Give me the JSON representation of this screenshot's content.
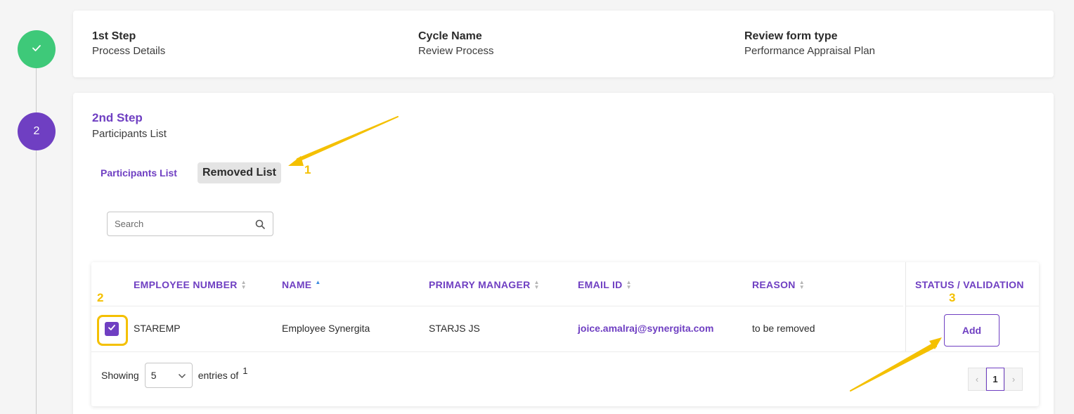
{
  "step1": {
    "items": [
      {
        "title": "1st Step",
        "value": "Process Details"
      },
      {
        "title": "Cycle Name",
        "value": "Review Process"
      },
      {
        "title": "Review form type",
        "value": "Performance Appraisal Plan"
      }
    ]
  },
  "step2": {
    "number": "2",
    "title": "2nd Step",
    "subtitle": "Participants List",
    "tabs": [
      {
        "label": "Participants List"
      },
      {
        "label": "Removed List"
      }
    ],
    "search": {
      "placeholder": "Search"
    },
    "table": {
      "columns": [
        "EMPLOYEE NUMBER",
        "NAME",
        "PRIMARY MANAGER",
        "EMAIL ID",
        "REASON",
        "STATUS / VALIDATION"
      ],
      "rows": [
        {
          "employee_number": "STAREMP",
          "name": "Employee Synergita",
          "primary_manager": "STARJS JS",
          "email": "joice.amalraj@synergita.com",
          "reason": "to be removed",
          "action": "Add",
          "checked": true
        }
      ]
    },
    "footer": {
      "showing": "Showing",
      "entries_value": "5",
      "entries_of": "entries of",
      "total": "1",
      "current_page": "1"
    }
  },
  "annotations": [
    "1",
    "2",
    "3"
  ],
  "colors": {
    "accent": "#6f3fc2",
    "done": "#3ec979",
    "highlight": "#f4c000"
  }
}
